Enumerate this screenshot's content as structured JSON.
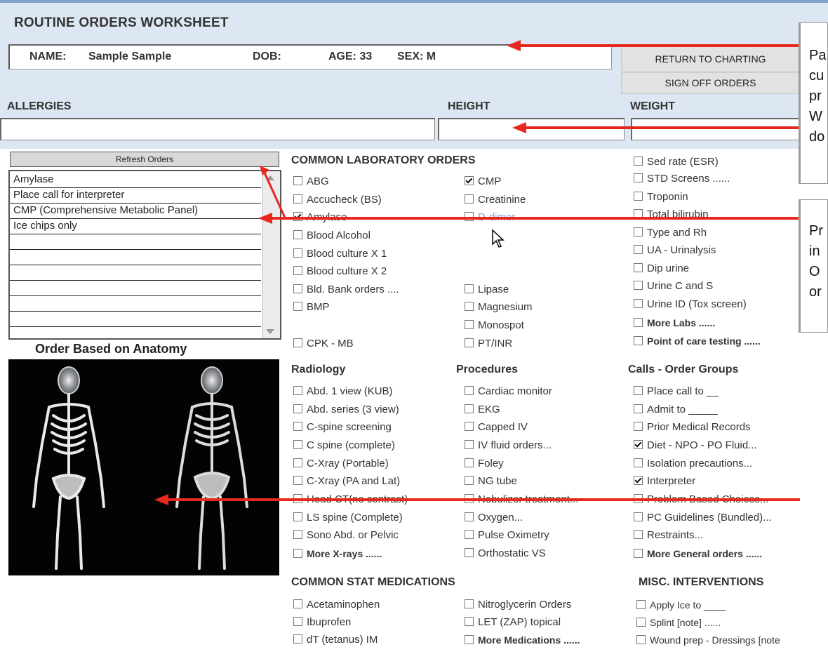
{
  "header": {
    "title": "ROUTINE ORDERS WORKSHEET",
    "name_label": "NAME:",
    "name_value": "Sample Sample",
    "dob_label": "DOB:",
    "age": "AGE: 33",
    "sex": "SEX: M"
  },
  "buttons": {
    "return": "RETURN TO CHARTING",
    "sign_off": "SIGN OFF ORDERS",
    "refresh": "Refresh Orders"
  },
  "fields": {
    "allergies": "ALLERGIES",
    "height": "HEIGHT",
    "weight": "WEIGHT"
  },
  "orders_list": [
    "Amylase",
    "Place call for interpreter",
    "CMP (Comprehensive Metabolic Panel)",
    "Ice chips only",
    "",
    "",
    "",
    "",
    "",
    ""
  ],
  "anatomy_title": "Order Based on Anatomy",
  "sections": {
    "lab": "COMMON LABORATORY ORDERS",
    "radiology": "Radiology",
    "procedures": "Procedures",
    "calls": "Calls - Order Groups",
    "meds": "COMMON STAT MEDICATIONS",
    "misc": "MISC. INTERVENTIONS"
  },
  "lab_col1": [
    {
      "label": "ABG",
      "checked": false
    },
    {
      "label": "Accucheck (BS)",
      "checked": false
    },
    {
      "label": "Amylase",
      "checked": true
    },
    {
      "label": "Blood Alcohol",
      "checked": false
    },
    {
      "label": "Blood culture X 1",
      "checked": false
    },
    {
      "label": "Blood culture X 2",
      "checked": false
    },
    {
      "label": "Bld. Bank orders ....",
      "checked": false
    },
    {
      "label": "BMP",
      "checked": false
    },
    {
      "label": "CPK - MB",
      "checked": false
    }
  ],
  "lab_col2": [
    {
      "label": "CMP",
      "checked": true
    },
    {
      "label": "Creatinine",
      "checked": false
    },
    {
      "label": "D-dimer",
      "checked": false
    },
    {
      "label": "Lipase",
      "checked": false
    },
    {
      "label": "Magnesium",
      "checked": false
    },
    {
      "label": "Monospot",
      "checked": false
    },
    {
      "label": "PT/INR",
      "checked": false
    }
  ],
  "lab_col3": [
    {
      "label": "Sed rate (ESR)",
      "checked": false
    },
    {
      "label": "STD Screens ......",
      "checked": false
    },
    {
      "label": "Troponin",
      "checked": false
    },
    {
      "label": "Total bilirubin",
      "checked": false
    },
    {
      "label": "Type and Rh",
      "checked": false
    },
    {
      "label": "UA - Urinalysis",
      "checked": false
    },
    {
      "label": "Dip urine",
      "checked": false
    },
    {
      "label": "Urine C and S",
      "checked": false
    },
    {
      "label": "Urine ID (Tox screen)",
      "checked": false
    },
    {
      "label": "More Labs ......",
      "checked": false
    },
    {
      "label": "Point of care testing ......",
      "checked": false
    }
  ],
  "radiology": [
    "Abd. 1 view  (KUB)",
    "Abd. series (3 view)",
    "C-spine screening",
    "C spine (complete)",
    "C-Xray (Portable)",
    "C-Xray (PA and Lat)",
    "Head CT(no contrast)",
    "LS spine (Complete)",
    "Sono Abd. or Pelvic",
    "More X-rays ......"
  ],
  "procedures": [
    "Cardiac monitor",
    "EKG",
    "Capped IV",
    "IV fluid orders...",
    "Foley",
    "NG tube",
    "Nebulizer treatment...",
    "Oxygen...",
    "Pulse Oximetry",
    "Orthostatic VS"
  ],
  "calls": [
    {
      "label": "Place call to __",
      "checked": false
    },
    {
      "label": "Admit to _____",
      "checked": false
    },
    {
      "label": "Prior Medical Records",
      "checked": false
    },
    {
      "label": "Diet - NPO - PO Fluid...",
      "checked": true
    },
    {
      "label": "Isolation precautions...",
      "checked": false
    },
    {
      "label": "Interpreter",
      "checked": true
    },
    {
      "label": "Problem Based Choices...",
      "checked": false
    },
    {
      "label": "PC Guidelines (Bundled)...",
      "checked": false
    },
    {
      "label": "Restraints...",
      "checked": false
    },
    {
      "label": "More General orders ......",
      "checked": false
    }
  ],
  "meds_col1": [
    "Acetaminophen",
    "Ibuprofen",
    "dT (tetanus) IM"
  ],
  "meds_col2": [
    "Nitroglycerin Orders",
    "LET (ZAP) topical",
    "More Medications ......"
  ],
  "misc": [
    "Apply Ice to ____",
    "Splint [note] ......",
    "Wound prep - Dressings [note"
  ],
  "callouts": {
    "top": [
      "Pa",
      "cu",
      "pr",
      "W",
      "do"
    ],
    "mid": [
      "Pr",
      "in",
      "O",
      "or"
    ]
  },
  "colors": {
    "accent_red": "#e8281e",
    "band": "#dde7f3"
  }
}
